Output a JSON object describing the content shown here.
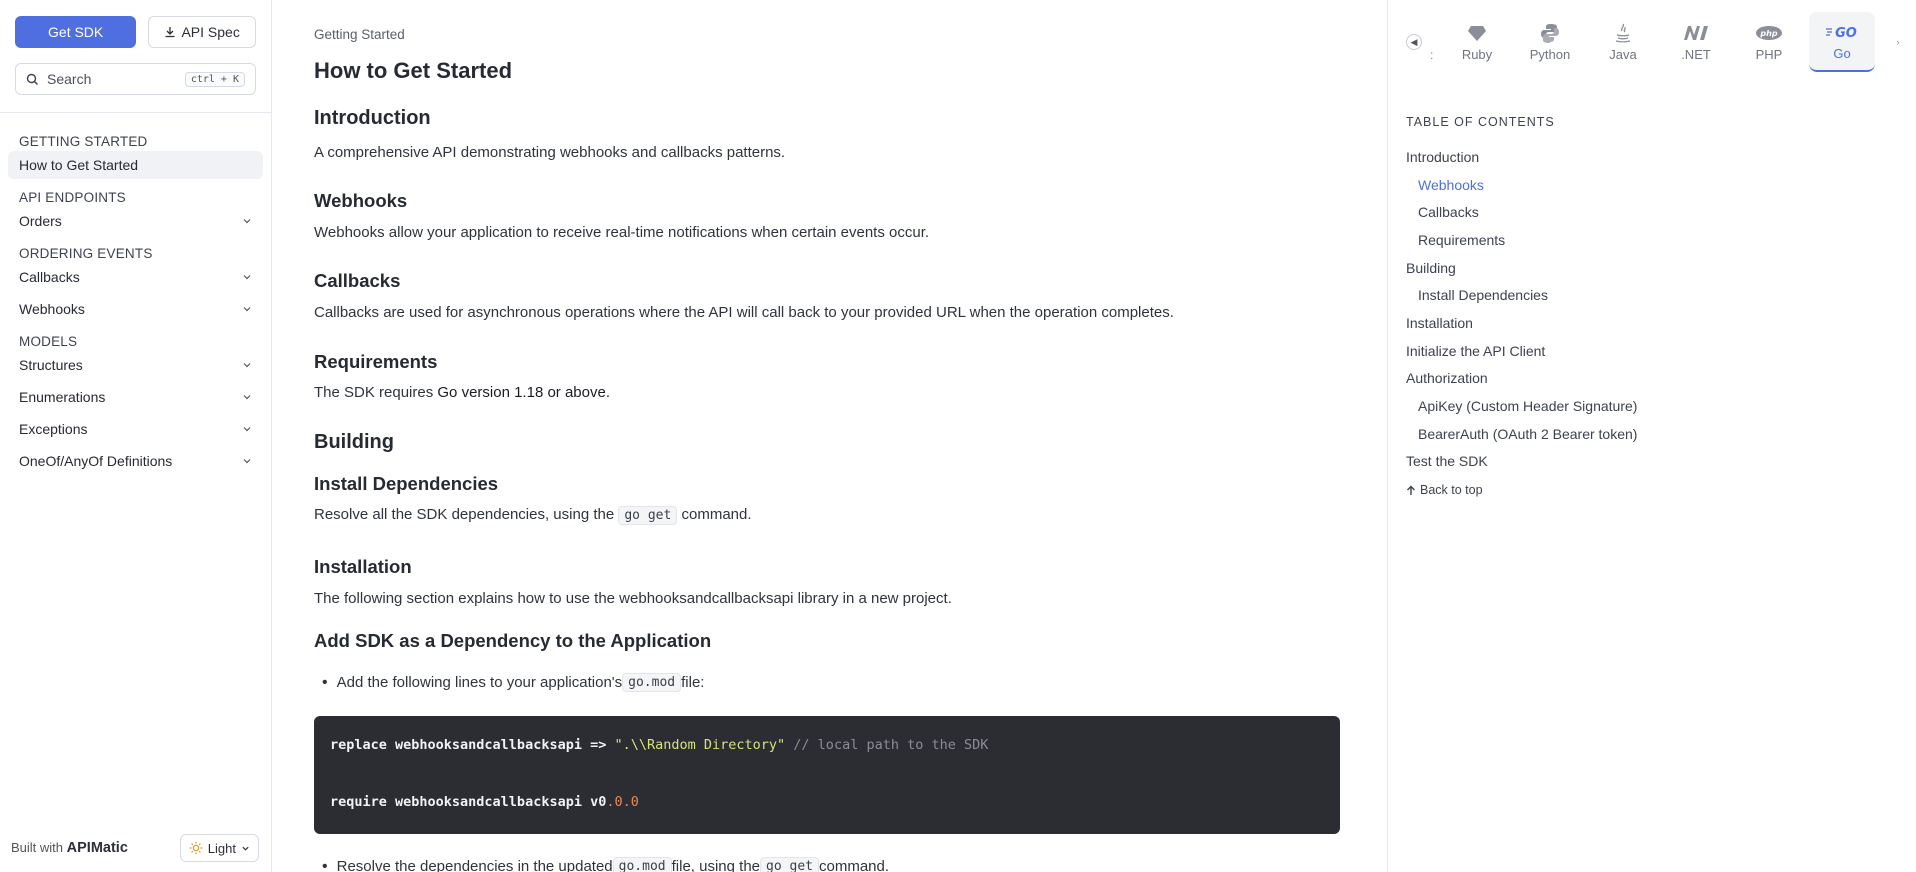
{
  "sidebar": {
    "get_sdk_label": "Get SDK",
    "api_spec_label": "API Spec",
    "search_placeholder": "Search",
    "search_shortcut": "ctrl + K",
    "sections": [
      {
        "title": "GETTING STARTED",
        "items": [
          {
            "label": "How to Get Started",
            "active": true,
            "expandable": false
          }
        ]
      },
      {
        "title": "API ENDPOINTS",
        "items": [
          {
            "label": "Orders",
            "expandable": true
          }
        ]
      },
      {
        "title": "ORDERING EVENTS",
        "items": [
          {
            "label": "Callbacks",
            "expandable": true
          },
          {
            "label": "Webhooks",
            "expandable": true
          }
        ]
      },
      {
        "title": "MODELS",
        "items": [
          {
            "label": "Structures",
            "expandable": true
          },
          {
            "label": "Enumerations",
            "expandable": true
          },
          {
            "label": "Exceptions",
            "expandable": true
          },
          {
            "label": "OneOf/AnyOf Definitions",
            "expandable": true
          }
        ]
      }
    ],
    "footer": {
      "built_with": "Built with",
      "brand": "APIMatic",
      "theme_label": "Light"
    }
  },
  "main": {
    "breadcrumb": "Getting Started",
    "title": "How to Get Started",
    "intro_heading": "Introduction",
    "intro_text": "A comprehensive API demonstrating webhooks and callbacks patterns.",
    "webhooks_heading": "Webhooks",
    "webhooks_text": "Webhooks allow your application to receive real-time notifications when certain events occur.",
    "callbacks_heading": "Callbacks",
    "callbacks_text": "Callbacks are used for asynchronous operations where the API will call back to your provided URL when the operation completes.",
    "requirements_heading": "Requirements",
    "requirements_prefix": "The SDK requires ",
    "requirements_strong": "Go version 1.18 or above.",
    "building_heading": "Building",
    "install_deps_heading": "Install Dependencies",
    "install_deps_prefix": "Resolve all the SDK dependencies, using the ",
    "install_deps_code": "go get",
    "install_deps_suffix": " command.",
    "installation_heading": "Installation",
    "installation_text": "The following section explains how to use the webhooksandcallbacksapi library in a new project.",
    "add_sdk_heading": "Add SDK as a Dependency to the Application",
    "bullet1_prefix": "Add the following lines to your application's ",
    "bullet1_code": "go.mod",
    "bullet1_suffix": " file:",
    "code_line1_kw": "replace webhooksandcallbacksapi => ",
    "code_line1_str": "\".\\\\Random Directory\"",
    "code_line1_cmt": " // local path to the SDK",
    "code_line2_kw": "require webhooksandcallbacksapi v0",
    "code_line2_num": ".0.0",
    "bullet2_prefix": "Resolve the dependencies in the updated ",
    "bullet2_code1": "go.mod",
    "bullet2_mid": " file, using the ",
    "bullet2_code2": "go get",
    "bullet2_suffix": " command."
  },
  "languages": {
    "items": [
      {
        "label": "Ruby",
        "icon": "ruby-icon"
      },
      {
        "label": "Python",
        "icon": "python-icon"
      },
      {
        "label": "Java",
        "icon": "java-icon"
      },
      {
        "label": ".NET",
        "icon": "dotnet-icon"
      },
      {
        "label": "PHP",
        "icon": "php-icon"
      },
      {
        "label": "Go",
        "icon": "go-icon",
        "active": true
      }
    ],
    "truncated_prefix": ":"
  },
  "toc": {
    "title": "TABLE OF CONTENTS",
    "items": [
      {
        "label": "Introduction",
        "level": 1
      },
      {
        "label": "Webhooks",
        "level": 2,
        "active": true
      },
      {
        "label": "Callbacks",
        "level": 2
      },
      {
        "label": "Requirements",
        "level": 2
      },
      {
        "label": "Building",
        "level": 1
      },
      {
        "label": "Install Dependencies",
        "level": 2
      },
      {
        "label": "Installation",
        "level": 1
      },
      {
        "label": "Initialize the API Client",
        "level": 1
      },
      {
        "label": "Authorization",
        "level": 1
      },
      {
        "label": "ApiKey (Custom Header Signature)",
        "level": 2
      },
      {
        "label": "BearerAuth (OAuth 2 Bearer token)",
        "level": 2
      },
      {
        "label": "Test the SDK",
        "level": 1
      }
    ],
    "back_to_top": "Back to top"
  },
  "colors": {
    "accent": "#4f6fe0",
    "code_bg": "#2c2c33"
  }
}
